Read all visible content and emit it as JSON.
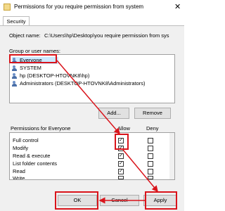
{
  "window": {
    "title": "Permissions for you require permission from system"
  },
  "tabs": [
    {
      "label": "Security"
    }
  ],
  "object_name": {
    "label": "Object name:",
    "value": "C:\\Users\\hp\\Desktop\\you require permission from sys"
  },
  "groups": {
    "label": "Group or user names:",
    "items": [
      {
        "name": "Everyone"
      },
      {
        "name": "SYSTEM"
      },
      {
        "name": "hp (DESKTOP-HTOVNK8\\hp)"
      },
      {
        "name": "Administrators (DESKTOP-HTOVNK8\\Administrators)"
      }
    ],
    "add_label": "Add...",
    "remove_label": "Remove"
  },
  "permissions": {
    "header_label": "Permissions for Everyone",
    "allow_label": "Allow",
    "deny_label": "Deny",
    "rows": [
      {
        "name": "Full control",
        "allow": true,
        "deny": false
      },
      {
        "name": "Modify",
        "allow": true,
        "deny": false
      },
      {
        "name": "Read & execute",
        "allow": true,
        "deny": false
      },
      {
        "name": "List folder contents",
        "allow": true,
        "deny": false
      },
      {
        "name": "Read",
        "allow": true,
        "deny": false
      },
      {
        "name": "Write",
        "allow": true,
        "deny": false
      }
    ]
  },
  "buttons": {
    "ok": "OK",
    "cancel": "Cancel",
    "apply": "Apply"
  },
  "colors": {
    "annotation": "#d9141b",
    "selection": "#cce8ff"
  },
  "icons": {
    "title": "folder-icon",
    "close": "close-icon",
    "user": "users-icon"
  }
}
